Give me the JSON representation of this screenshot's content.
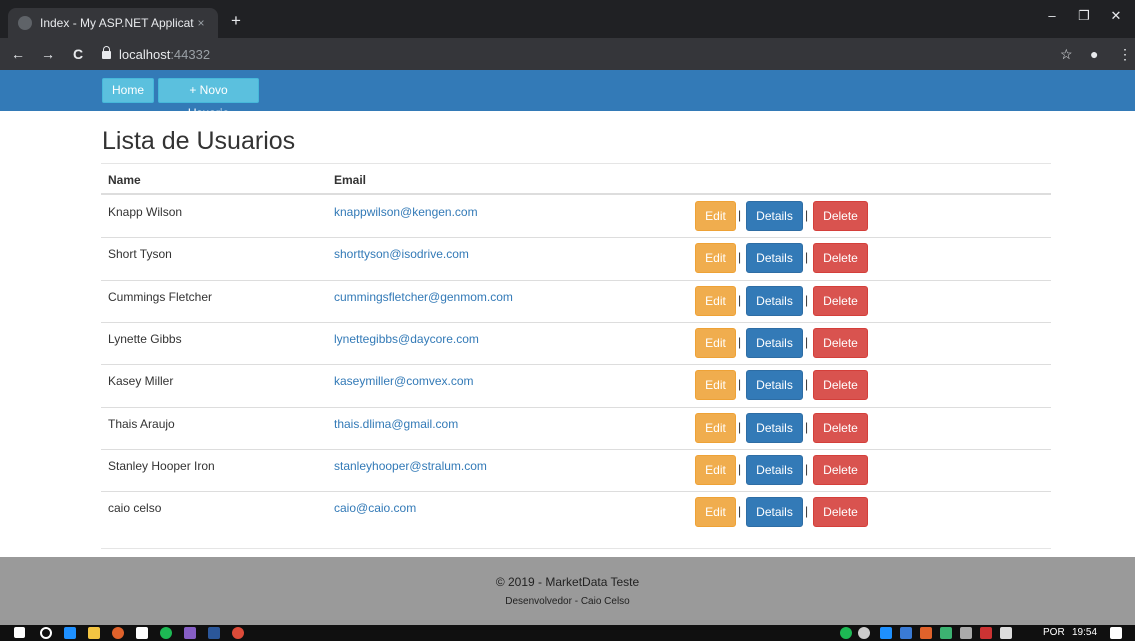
{
  "browser": {
    "tab_title": "Index - My ASP.NET Application",
    "tab_close": "×",
    "new_tab": "+",
    "url_host": "localhost",
    "url_port": ":44332",
    "minimize": "–",
    "restore": "❐",
    "close": "✕",
    "back": "←",
    "forward": "→",
    "reload": "C",
    "star": "☆",
    "profile": "●",
    "menu": "⋮"
  },
  "navbar": {
    "home_label": "Home",
    "new_user_label": "+ Novo Usuario"
  },
  "page": {
    "title": "Lista de Usuarios",
    "headers": {
      "name": "Name",
      "email": "Email"
    },
    "actions": {
      "edit": "Edit",
      "details": "Details",
      "delete": "Delete",
      "separator": "|"
    },
    "users": [
      {
        "name": "Knapp Wilson",
        "email": "knappwilson@kengen.com"
      },
      {
        "name": "Short Tyson",
        "email": "shorttyson@isodrive.com"
      },
      {
        "name": "Cummings Fletcher",
        "email": "cummingsfletcher@genmom.com"
      },
      {
        "name": "Lynette Gibbs",
        "email": "lynettegibbs@daycore.com"
      },
      {
        "name": "Kasey Miller",
        "email": "kaseymiller@comvex.com"
      },
      {
        "name": "Thais Araujo",
        "email": "thais.dlima@gmail.com"
      },
      {
        "name": "Stanley Hooper Iron",
        "email": "stanleyhooper@stralum.com"
      },
      {
        "name": "caio celso",
        "email": "caio@caio.com"
      }
    ]
  },
  "footer": {
    "copyright": "© 2019 - MarketData Teste",
    "developer": "Desenvolvedor - Caio Celso"
  },
  "taskbar": {
    "language": "POR",
    "time": "19:54"
  },
  "colors": {
    "navbar": "#337ab7",
    "edit": "#f0ad4e",
    "details": "#337ab7",
    "delete": "#d9534f",
    "link": "#337ab7"
  }
}
